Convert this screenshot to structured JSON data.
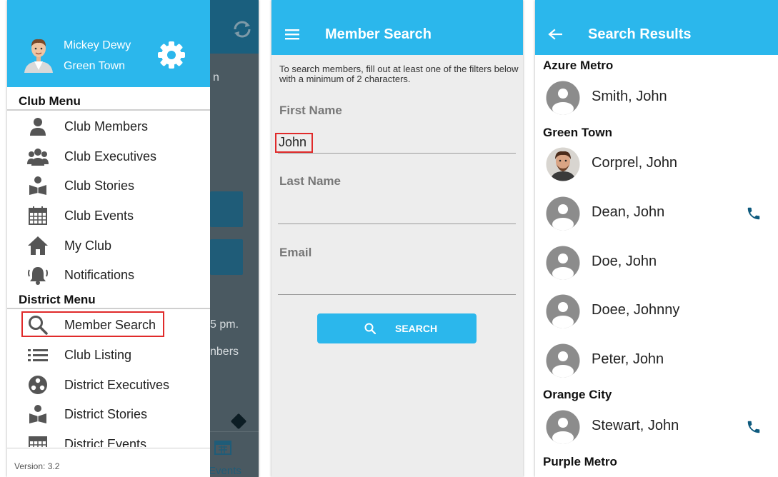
{
  "drawer": {
    "user": {
      "name": "Mickey Dewy",
      "club": "Green Town"
    },
    "club_menu": {
      "title": "Club Menu",
      "items": [
        {
          "label": "Club Members",
          "icon": "person-icon"
        },
        {
          "label": "Club Executives",
          "icon": "group-icon"
        },
        {
          "label": "Club Stories",
          "icon": "book-reader-icon"
        },
        {
          "label": "Club Events",
          "icon": "calendar-icon"
        },
        {
          "label": "My Club",
          "icon": "home-icon"
        },
        {
          "label": "Notifications",
          "icon": "bell-icon"
        }
      ]
    },
    "district_menu": {
      "title": "District Menu",
      "items": [
        {
          "label": "Member Search",
          "icon": "search-icon",
          "highlighted": true
        },
        {
          "label": "Club Listing",
          "icon": "list-icon"
        },
        {
          "label": "District Executives",
          "icon": "district-group-icon"
        },
        {
          "label": "District Stories",
          "icon": "book-reader-icon"
        },
        {
          "label": "District Events",
          "icon": "calendar-icon"
        }
      ]
    },
    "version": "Version: 3.2",
    "background": {
      "fragment_1": "n",
      "fragment_2": "5 pm.",
      "fragment_3": "nbers",
      "tab_label": "Events"
    }
  },
  "member_search": {
    "title": "Member Search",
    "instructions": "To search members, fill out at least one of the filters below with a minimum of 2 characters.",
    "fields": {
      "first_name": {
        "label": "First Name",
        "value": "John"
      },
      "last_name": {
        "label": "Last Name",
        "value": ""
      },
      "email": {
        "label": "Email",
        "value": ""
      }
    },
    "search_button": "SEARCH"
  },
  "search_results": {
    "title": "Search Results",
    "groups": [
      {
        "name": "Azure Metro",
        "members": [
          {
            "name": "Smith, John",
            "photo": false,
            "phone": false
          }
        ]
      },
      {
        "name": "Green Town",
        "members": [
          {
            "name": "Corprel, John",
            "photo": true,
            "phone": false
          },
          {
            "name": "Dean, John",
            "photo": false,
            "phone": true
          },
          {
            "name": "Doe, John",
            "photo": false,
            "phone": false
          },
          {
            "name": "Doee, Johnny",
            "photo": false,
            "phone": false
          },
          {
            "name": "Peter, John",
            "photo": false,
            "phone": false
          }
        ]
      },
      {
        "name": "Orange City",
        "members": [
          {
            "name": "Stewart, John",
            "photo": false,
            "phone": true
          }
        ]
      },
      {
        "name": "Purple Metro",
        "members": []
      }
    ]
  },
  "colors": {
    "primary": "#2bb7ec",
    "phone": "#0e5a7e",
    "highlight": "#e02a2a",
    "dim_overlay": "#4a5961"
  }
}
